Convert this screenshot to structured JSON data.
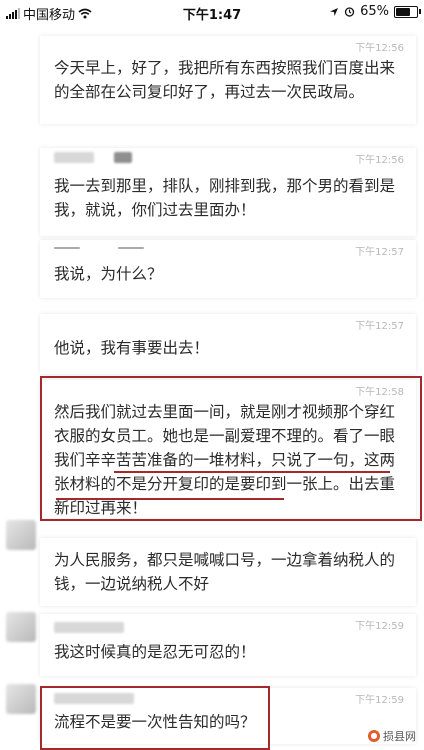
{
  "status_bar": {
    "carrier": "中国移动",
    "time": "下午1:47",
    "battery": "65%",
    "battery_level": 0.65
  },
  "messages": [
    {
      "time": "下午12:56",
      "text": "今天早上，好了，我把所有东西按照我们百度出来的全部在公司复印好了，再过去一次民政局。"
    },
    {
      "time": "下午12:56",
      "text": "我一去到那里，排队，刚排到我，那个男的看到是我，就说，你们过去里面办！"
    },
    {
      "time": "下午12:57",
      "text": "我说，为什么？"
    },
    {
      "time": "下午12:57",
      "text": "他说，我有事要出去！"
    },
    {
      "time": "下午12:58",
      "text": "然后我们就过去里面一间，就是刚才视频那个穿红衣服的女员工。她也是一副爱理不理的。看了一眼我们辛辛苦苦准备的一堆材料，只说了一句，这两张材料的不是分开复印的是要印到一张上。出去重新印过再来！"
    },
    {
      "time": "",
      "text": "为人民服务，都只是喊喊口号，一边拿着纳税人的钱，一边说纳税人不好"
    },
    {
      "time": "下午12:59",
      "text": "我这时候真的是忍无可忍的！"
    },
    {
      "time": "下午12:59",
      "text": "流程不是要一次性告知的吗？"
    }
  ],
  "watermark": "损县网",
  "colors": {
    "highlight": "#a3292a",
    "timestamp": "#b8b8b8"
  }
}
